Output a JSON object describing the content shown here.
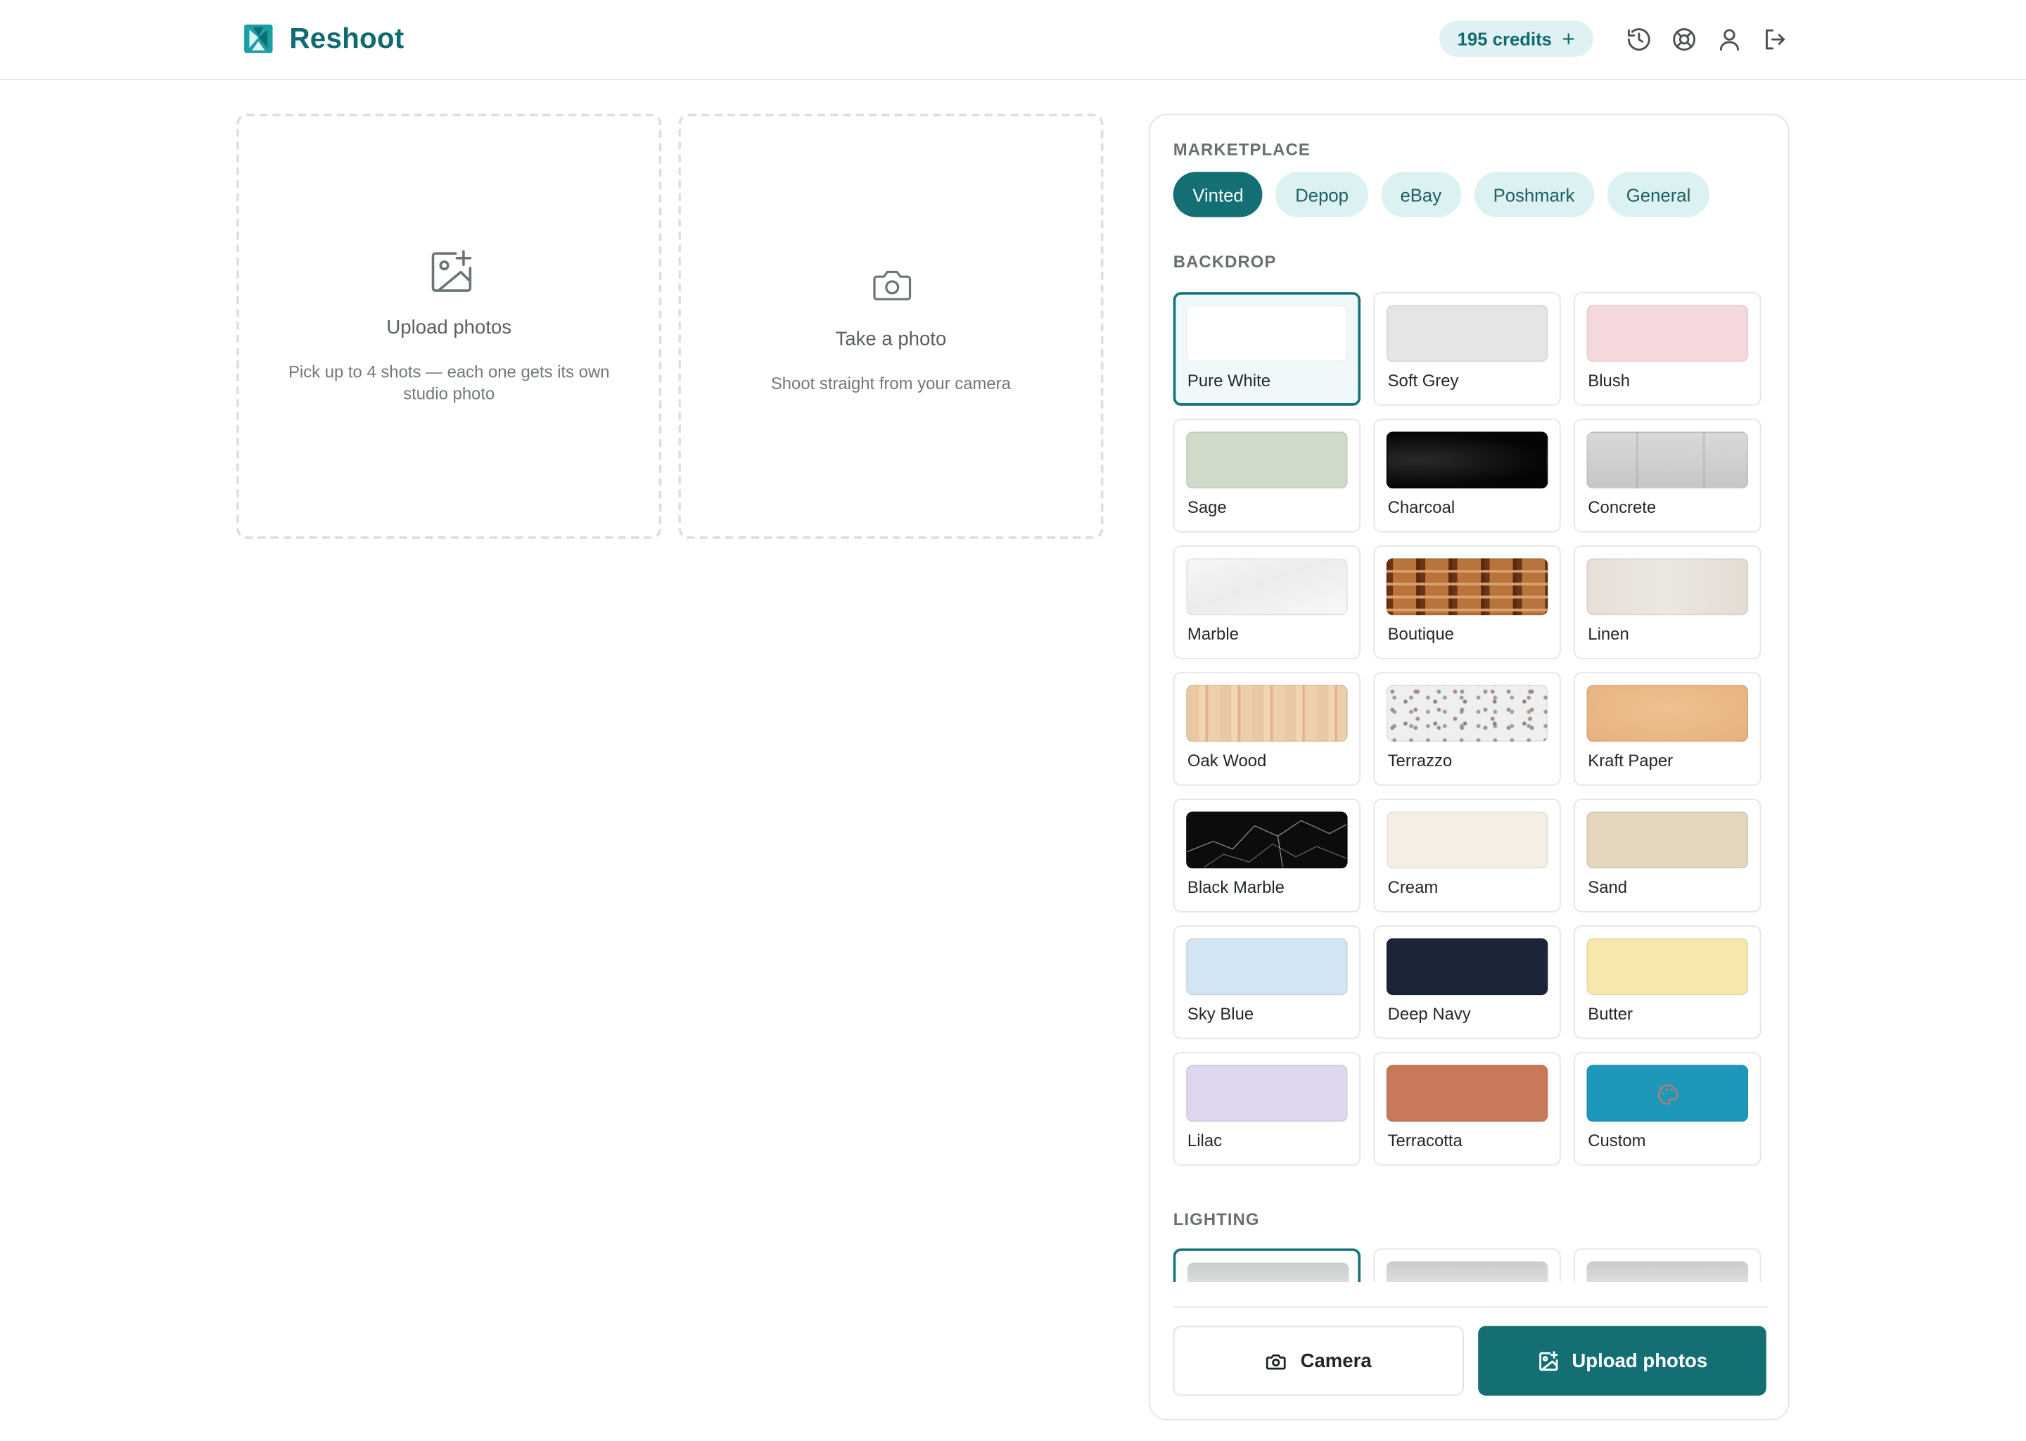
{
  "app": {
    "name": "Reshoot",
    "brand_color": "#0f6b6f"
  },
  "header": {
    "credits_label": "195 credits",
    "credits_plus": "+",
    "icons": [
      "history-icon",
      "help-lifebuoy-icon",
      "account-icon",
      "logout-icon"
    ]
  },
  "upload_zone": {
    "title": "Upload photos",
    "subtitle_line1": "Pick up to 4 shots — each one gets its own",
    "subtitle_line2": "studio photo",
    "icon": "image-plus-icon"
  },
  "camera_zone": {
    "title": "Take a photo",
    "subtitle": "Shoot straight from your camera",
    "icon": "camera-icon"
  },
  "panel": {
    "marketplace_label": "MARKETPLACE",
    "marketplaces": [
      "Vinted",
      "Depop",
      "eBay",
      "Poshmark",
      "General"
    ],
    "marketplace_selected": "Vinted",
    "backdrop_label": "BACKDROP",
    "backdrop_selected": "Pure White",
    "backdrops": [
      {
        "label": "Pure White",
        "color": "#ffffff"
      },
      {
        "label": "Soft Grey",
        "color": "#e5e5e4"
      },
      {
        "label": "Blush",
        "color": "#f5d8dc"
      },
      {
        "label": "Sage",
        "color": "#cddbc8"
      },
      {
        "label": "Charcoal",
        "color": "#0a0a0a"
      },
      {
        "label": "Concrete",
        "color": "#cfd1d1"
      },
      {
        "label": "Marble",
        "color": "#f3f3f3"
      },
      {
        "label": "Boutique",
        "color": "#8a4a25"
      },
      {
        "label": "Linen",
        "color": "#e7e2da"
      },
      {
        "label": "Oak Wood",
        "color": "#e8c8a2"
      },
      {
        "label": "Terrazzo",
        "color": "#efefef"
      },
      {
        "label": "Kraft Paper",
        "color": "#e9b888"
      },
      {
        "label": "Black Marble",
        "color": "#0c0c0c"
      },
      {
        "label": "Cream",
        "color": "#f5eee2"
      },
      {
        "label": "Sand",
        "color": "#e3d6bd"
      },
      {
        "label": "Sky Blue",
        "color": "#d3e5f3"
      },
      {
        "label": "Deep Navy",
        "color": "#1b2538"
      },
      {
        "label": "Butter",
        "color": "#f6e7ad"
      },
      {
        "label": "Lilac",
        "color": "#dfd7ef"
      },
      {
        "label": "Terracotta",
        "color": "#c8785b"
      },
      {
        "label": "Custom",
        "color": "#1d98ba",
        "icon": "palette-icon"
      }
    ],
    "lighting_label": "LIGHTING",
    "camera_button": "Camera",
    "upload_button": "Upload photos"
  }
}
